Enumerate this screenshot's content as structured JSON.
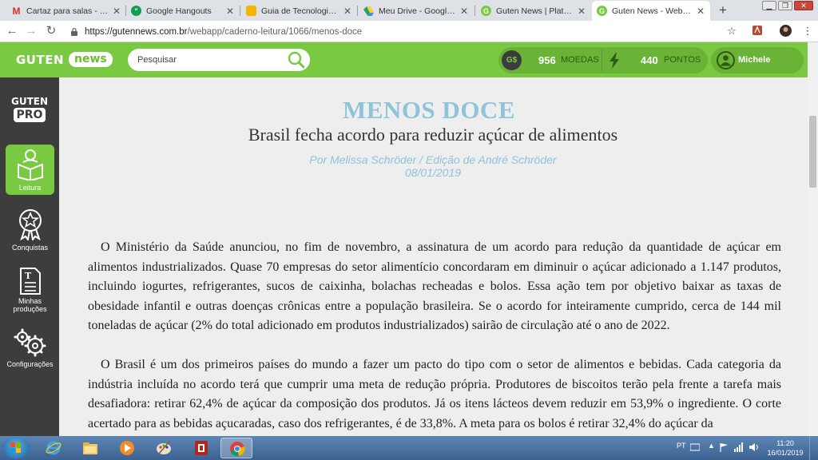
{
  "browser": {
    "tabs": [
      {
        "title": "Cartaz para salas - Códig",
        "icon": "gmail-icon",
        "icon_color": "#d93025"
      },
      {
        "title": "Google Hangouts",
        "icon": "hangouts-icon",
        "icon_color": "#0f9d58"
      },
      {
        "title": "Guia de Tecnologia para",
        "icon": "slides-icon",
        "icon_color": "#f4b400"
      },
      {
        "title": "Meu Drive - Google Drive",
        "icon": "drive-icon",
        "icon_color": "#1fa463"
      },
      {
        "title": "Guten News | Plataforma",
        "icon": "guten-icon",
        "icon_color": "#7ac943"
      },
      {
        "title": "Guten News - Webapp",
        "icon": "guten-icon",
        "icon_color": "#7ac943",
        "active": true
      }
    ],
    "url_host": "https://gutennews.com.br",
    "url_path": "/webapp/caderno-leitura/1066/menos-doce"
  },
  "header": {
    "logo_left": "GUTEN",
    "logo_right": "news",
    "search_placeholder": "Pesquisar",
    "coins_icon_label": "G$",
    "coins_value": "956",
    "coins_label": "MOEDAS",
    "points_value": "440",
    "points_label": "PONTOS",
    "user_name": "Michele"
  },
  "sidebar": {
    "pro_logo_top": "GUTEN",
    "pro_logo_bottom": "PRO",
    "items": [
      {
        "label": "Leitura",
        "icon": "book-reader-icon",
        "active": true
      },
      {
        "label": "Conquistas",
        "icon": "medal-icon"
      },
      {
        "label_line1": "Minhas",
        "label_line2": "produções",
        "icon": "document-icon"
      },
      {
        "label": "Configurações",
        "icon": "gears-icon"
      }
    ]
  },
  "article": {
    "title": "MENOS DOCE",
    "subtitle": "Brasil fecha acordo para reduzir açúcar de alimentos",
    "author": "Por Melissa Schröder / Edição de André Schröder",
    "date": "08/01/2019",
    "paragraphs": [
      "O Ministério da Saúde anunciou, no fim de novembro, a assinatura de um acordo para redução da quantidade de açúcar em alimentos industrializados. Quase 70 empresas do setor alimentício concordaram em diminuir o açúcar adicionado a 1.147 produtos, incluindo iogurtes, refrigerantes, sucos de caixinha, bolachas recheadas e bolos. Essa ação tem por objetivo baixar as taxas de obesidade infantil e outras doenças crônicas entre a população brasileira. Se o acordo for inteiramente cumprido, cerca de 144 mil toneladas de açúcar (2% do total adicionado em produtos industrializados) sairão de circulação até o ano de 2022.",
      "O Brasil é um dos primeiros países do mundo a fazer um pacto do tipo com o setor de alimentos e bebidas. Cada categoria da indústria incluída no acordo terá que cumprir uma meta de redução própria. Produtores de biscoitos terão pela frente a tarefa mais desafiadora: retirar 62,4% de açúcar da composição dos produtos. Já os itens lácteos devem reduzir em 53,9% o ingrediente. O corte acertado para as bebidas açucaradas, caso dos refrigerantes, é de 33,8%. A meta para os bolos é retirar 32,4% do açúcar da"
    ]
  },
  "taskbar": {
    "language": "PT",
    "time": "11:20",
    "date": "16/01/2019"
  },
  "colors": {
    "brand_green": "#7ac943",
    "title_blue": "#8fc3d9",
    "sidebar_dark": "#3d3d3d"
  }
}
